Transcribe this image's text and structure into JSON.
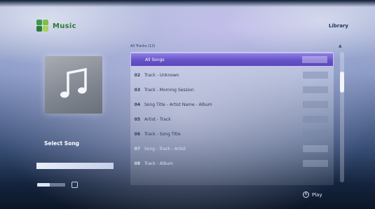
{
  "app": {
    "logo_text": "Music",
    "header_right": "Library"
  },
  "left": {
    "now_playing_title": "Select Song",
    "now_playing_sub": "",
    "progress": 1.0,
    "volume_label": "",
    "volume_value": "",
    "volume_level": 0.45
  },
  "list": {
    "caption": "All Tracks (12)",
    "rows": [
      {
        "num": "",
        "title": "All Songs",
        "duration": "",
        "selected": true
      },
      {
        "num": "02",
        "title": "Track - Unknown",
        "duration": "",
        "selected": false
      },
      {
        "num": "03",
        "title": "Track - Morning Session",
        "duration": "",
        "selected": false
      },
      {
        "num": "04",
        "title": "Song Title - Artist Name - Album",
        "duration": "",
        "selected": false
      },
      {
        "num": "05",
        "title": "Artist - Track",
        "duration": "",
        "selected": false
      },
      {
        "num": "06",
        "title": "Track - Song Title",
        "duration": "",
        "selected": false
      },
      {
        "num": "07",
        "title": "Song - Track - Artist",
        "duration": "",
        "selected": false
      },
      {
        "num": "08",
        "title": "Track - Album",
        "duration": "",
        "selected": false
      }
    ]
  },
  "footer": {
    "key": "A",
    "label": "Play"
  },
  "colors": {
    "selection": "#6752c8",
    "logo_green": "#2d7a38"
  },
  "icons": [
    "music-note-icon",
    "logo-icon",
    "scroll-up-icon",
    "volume-icon"
  ]
}
